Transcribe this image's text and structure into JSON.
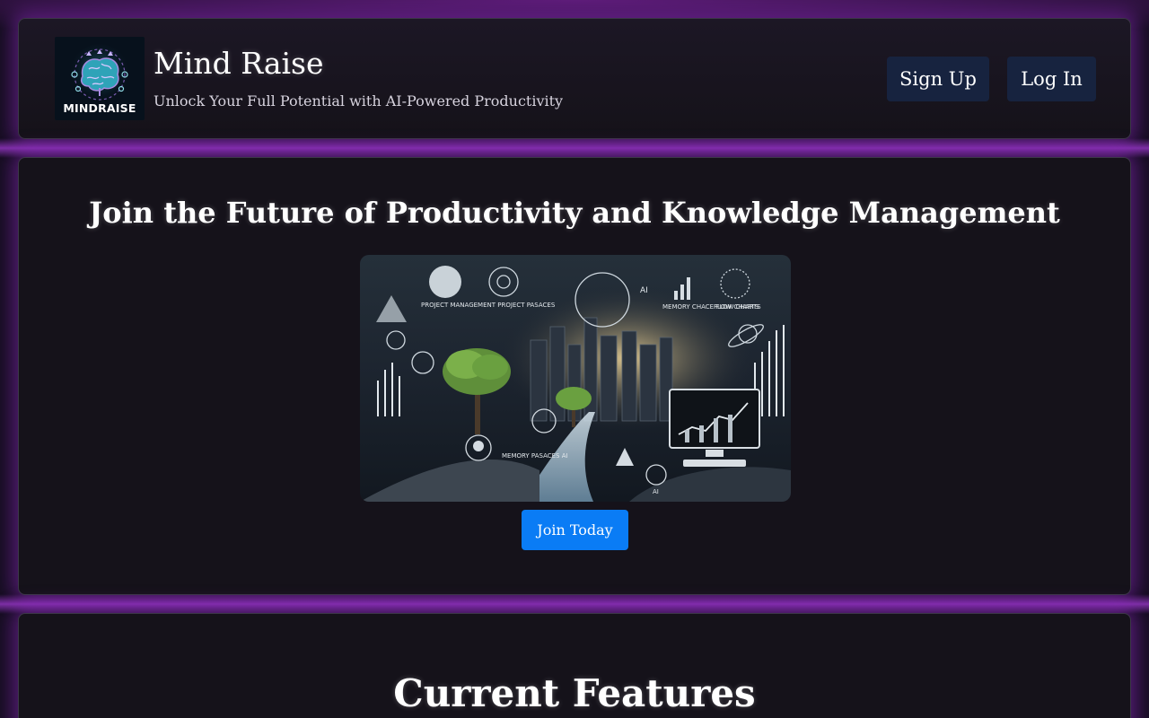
{
  "header": {
    "logo_text": "MINDRAISE",
    "title": "Mind Raise",
    "tagline": "Unlock Your Full Potential with AI-Powered Productivity",
    "signup_label": "Sign Up",
    "login_label": "Log In"
  },
  "hero": {
    "title": "Join the Future of Productivity and Knowledge Management",
    "image_labels": [
      "PROJECT MANAGEMENT PROJECT PASACES",
      "AI",
      "MEMORY CHACE FLOW CHARTS",
      "FLOW CHARTS",
      "MEMORY PASACES AI",
      "AI"
    ],
    "join_label": "Join Today"
  },
  "features": {
    "title": "Current Features"
  },
  "colors": {
    "background": "#140d1f",
    "panel": "#17141d",
    "glow": "#a03cd2",
    "header_button": "#17233f",
    "primary_button": "#0a7cf5"
  }
}
